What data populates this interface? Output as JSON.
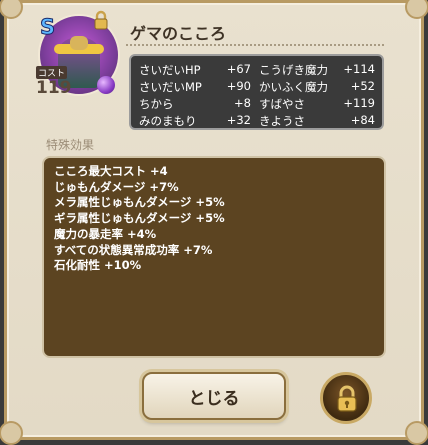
{
  "header": {
    "title": "ゲマのこころ",
    "rank": "S",
    "cost_label": "コスト",
    "cost_value": "119"
  },
  "stats": [
    {
      "label": "さいだいHP",
      "value": "+67"
    },
    {
      "label": "こうげき魔力",
      "value": "+114"
    },
    {
      "label": "さいだいMP",
      "value": "+90"
    },
    {
      "label": "かいふく魔力",
      "value": "+52"
    },
    {
      "label": "ちから",
      "value": "+8"
    },
    {
      "label": "すばやさ",
      "value": "+119"
    },
    {
      "label": "みのまもり",
      "value": "+32"
    },
    {
      "label": "きようさ",
      "value": "+84"
    }
  ],
  "effects_section": {
    "label": "特殊効果",
    "items": [
      "こころ最大コスト +4",
      "じゅもんダメージ +7%",
      "メラ属性じゅもんダメージ +5%",
      "ギラ属性じゅもんダメージ +5%",
      "魔力の暴走率 +4%",
      "すべての状態異常成功率 +7%",
      "石化耐性 +10%"
    ]
  },
  "buttons": {
    "close_label": "とじる"
  },
  "icons": {
    "lock": "lock-icon",
    "gem": "gem-icon"
  },
  "colors": {
    "stats_bg": "#3a3a3a",
    "effects_bg": "#5c4421",
    "panel_bg": "#e6dfcb"
  }
}
